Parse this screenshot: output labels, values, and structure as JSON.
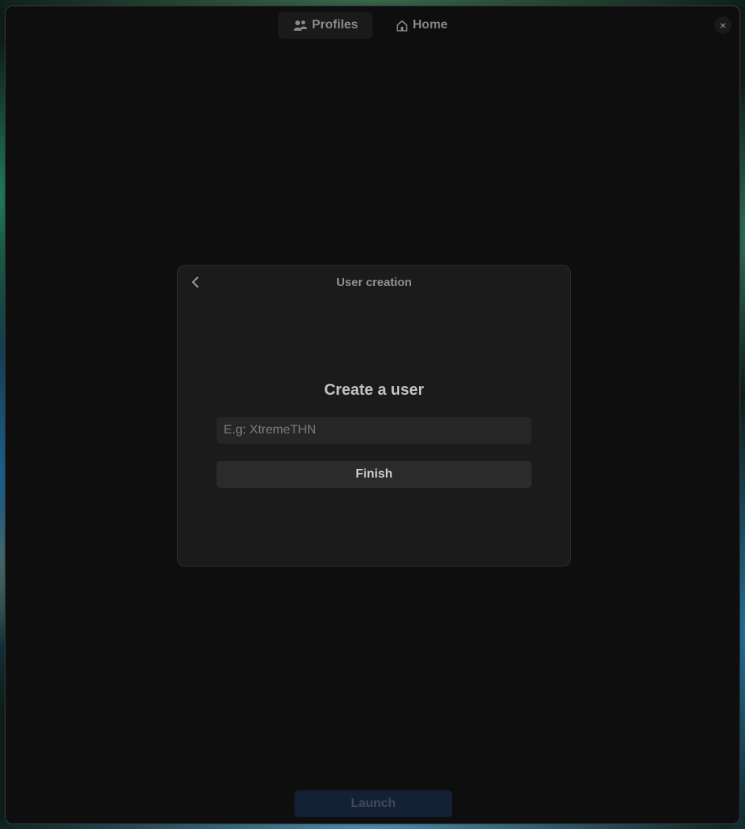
{
  "nav": {
    "profiles_label": "Profiles",
    "home_label": "Home",
    "profiles_icon": "users-icon",
    "home_icon": "home-icon",
    "close_glyph": "×"
  },
  "dialog": {
    "title": "User creation",
    "heading": "Create a user",
    "input_placeholder": "E.g: XtremeTHN",
    "input_value": "",
    "finish_label": "Finish"
  },
  "footer": {
    "launch_label": "Launch"
  },
  "colors": {
    "window_bg": "#0e0e0e",
    "dialog_bg": "#1b1b1b",
    "launch_bg": "#142033"
  }
}
